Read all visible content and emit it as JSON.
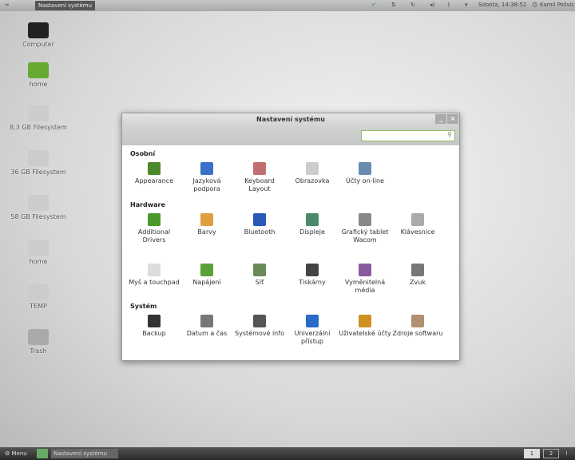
{
  "top_panel": {
    "window_title": "Nastavení systému",
    "clock": "Sobota, 14:38:52",
    "user": "Kamil Pošvic",
    "icons": [
      "mint-logo-icon",
      "shield-check-icon",
      "network-icon",
      "update-icon",
      "volume-icon",
      "bluetooth-icon",
      "signal-icon",
      "user-icon"
    ]
  },
  "bottom_panel": {
    "menu_label": "Menu",
    "task_label": "Nastavení systému",
    "workspaces": [
      "1",
      "2"
    ],
    "more": "!"
  },
  "desktop": [
    {
      "label": "Computer",
      "icon": "computer-icon"
    },
    {
      "label": "home",
      "icon": "home-folder-icon"
    },
    {
      "label": "8,3 GB Filesystem",
      "icon": "drive-icon"
    },
    {
      "label": "36 GB Filesystem",
      "icon": "drive-icon"
    },
    {
      "label": "58 GB Filesystem",
      "icon": "drive-icon"
    },
    {
      "label": "home",
      "icon": "drive-icon"
    },
    {
      "label": "TEMP",
      "icon": "drive-icon"
    },
    {
      "label": "Trash",
      "icon": "trash-icon"
    }
  ],
  "window": {
    "title": "Nastavení systému",
    "search_value": "",
    "sections": [
      {
        "title": "Osobní",
        "rows": [
          [
            {
              "label": "Appearance",
              "color": "#4a8a2a"
            },
            {
              "label": "Jazyková podpora",
              "color": "#3a6fc8"
            },
            {
              "label": "Keyboard Layout",
              "color": "#c07070"
            },
            {
              "label": "Obrazovka",
              "color": "#cccccc"
            },
            {
              "label": "Účty on-line",
              "color": "#6a8ab0"
            }
          ]
        ]
      },
      {
        "title": "Hardware",
        "rows": [
          [
            {
              "label": "Additional Drivers",
              "color": "#4a9a2a"
            },
            {
              "label": "Barvy",
              "color": "#e0a040"
            },
            {
              "label": "Bluetooth",
              "color": "#2a5ab8"
            },
            {
              "label": "Displeje",
              "color": "#4a8a6a"
            },
            {
              "label": "Grafický tablet Wacom",
              "color": "#888888"
            },
            {
              "label": "Klávesnice",
              "color": "#aaaaaa"
            }
          ],
          [
            {
              "label": "Myš a touchpad",
              "color": "#dddddd"
            },
            {
              "label": "Napájení",
              "color": "#5aa03a"
            },
            {
              "label": "Síť",
              "color": "#6a8a5a"
            },
            {
              "label": "Tiskárny",
              "color": "#444444"
            },
            {
              "label": "Vyměnitelná média",
              "color": "#8a5aa0"
            },
            {
              "label": "Zvuk",
              "color": "#777777"
            }
          ]
        ]
      },
      {
        "title": "Systém",
        "rows": [
          [
            {
              "label": "Backup",
              "color": "#333333"
            },
            {
              "label": "Datum a čas",
              "color": "#777777"
            },
            {
              "label": "Systémové info",
              "color": "#555555"
            },
            {
              "label": "Univerzální přístup",
              "color": "#2a6ac8"
            },
            {
              "label": "Uživatelské účty",
              "color": "#d09020"
            },
            {
              "label": "Zdroje softwaru",
              "color": "#b09070"
            }
          ]
        ]
      }
    ]
  }
}
